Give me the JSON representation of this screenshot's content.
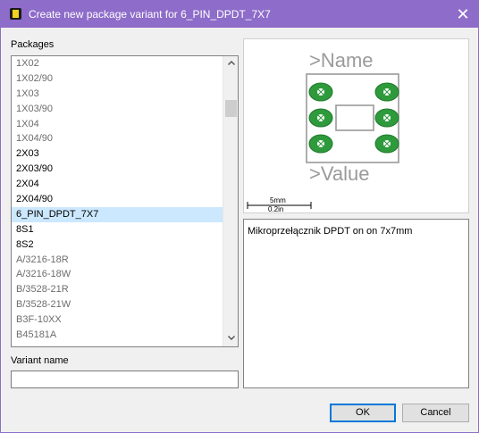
{
  "window": {
    "title": "Create new package variant for 6_PIN_DPDT_7X7",
    "close_glyph": "✕"
  },
  "packages": {
    "label": "Packages",
    "items": [
      {
        "label": "1X02",
        "dim": true
      },
      {
        "label": "1X02/90",
        "dim": true
      },
      {
        "label": "1X03",
        "dim": true
      },
      {
        "label": "1X03/90",
        "dim": true
      },
      {
        "label": "1X04",
        "dim": true
      },
      {
        "label": "1X04/90",
        "dim": true
      },
      {
        "label": "2X03",
        "dim": false
      },
      {
        "label": "2X03/90",
        "dim": false
      },
      {
        "label": "2X04",
        "dim": false
      },
      {
        "label": "2X04/90",
        "dim": false
      },
      {
        "label": "6_PIN_DPDT_7X7",
        "dim": false,
        "selected": true
      },
      {
        "label": "8S1",
        "dim": false
      },
      {
        "label": "8S2",
        "dim": false
      },
      {
        "label": "A/3216-18R",
        "dim": true
      },
      {
        "label": "A/3216-18W",
        "dim": true
      },
      {
        "label": "B/3528-21R",
        "dim": true
      },
      {
        "label": "B/3528-21W",
        "dim": true
      },
      {
        "label": "B3F-10XX",
        "dim": true
      },
      {
        "label": "B45181A",
        "dim": true
      }
    ],
    "selected": "6_PIN_DPDT_7X7"
  },
  "preview": {
    "name_label": ">Name",
    "value_label": ">Value",
    "scale_top": "5mm",
    "scale_bottom": "0.2in",
    "pad_color": "#2e9a3c",
    "outline_color": "#9a9a9a"
  },
  "description": {
    "text": "Mikroprzełącznik DPDT on on 7x7mm"
  },
  "variant": {
    "label": "Variant name",
    "value": ""
  },
  "buttons": {
    "ok": "OK",
    "cancel": "Cancel"
  },
  "colors": {
    "titlebar": "#8e6cc9",
    "selection": "#cce8ff",
    "default_button_border": "#0078d7"
  }
}
